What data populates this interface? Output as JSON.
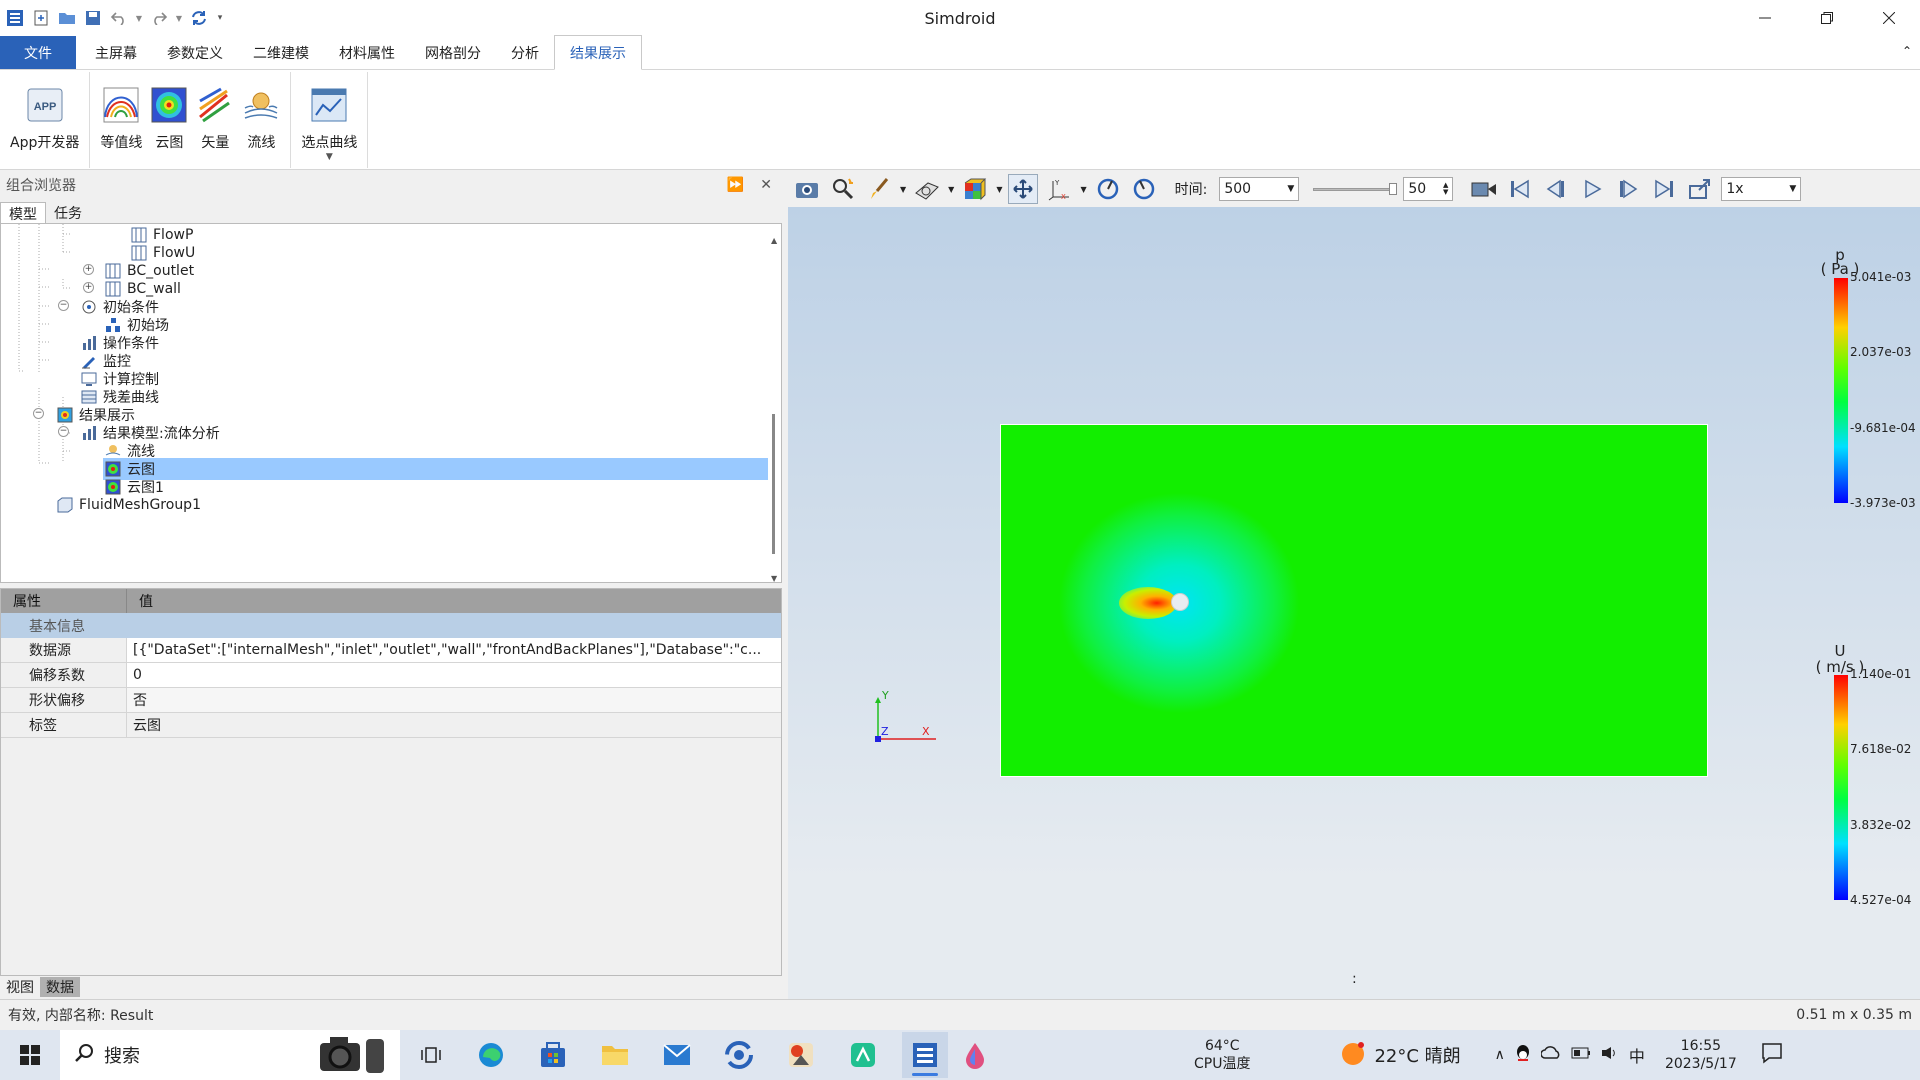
{
  "window": {
    "title": "Simdroid"
  },
  "ribbon_tabs": [
    "文件",
    "主屏幕",
    "参数定义",
    "二维建模",
    "材料属性",
    "网格剖分",
    "分析",
    "结果展示"
  ],
  "active_tab": "结果展示",
  "ribbon": {
    "app_dev": "App开发器",
    "contour_line": "等值线",
    "cloud": "云图",
    "vector": "矢量",
    "streamline": "流线",
    "pick_curve": "选点曲线"
  },
  "browser": {
    "title": "组合浏览器",
    "tabs": [
      "模型",
      "任务"
    ],
    "tree": [
      {
        "label": "FlowP"
      },
      {
        "label": "FlowU"
      },
      {
        "label": "BC_outlet"
      },
      {
        "label": "BC_wall"
      },
      {
        "label": "初始条件"
      },
      {
        "label": "初始场"
      },
      {
        "label": "操作条件"
      },
      {
        "label": "监控"
      },
      {
        "label": "计算控制"
      },
      {
        "label": "残差曲线"
      },
      {
        "label": "结果展示"
      },
      {
        "label": "结果模型:流体分析"
      },
      {
        "label": "流线"
      },
      {
        "label": "云图"
      },
      {
        "label": "云图1"
      },
      {
        "label": "FluidMeshGroup1"
      }
    ]
  },
  "properties": {
    "col_prop": "属性",
    "col_value": "值",
    "group": "基本信息",
    "rows": [
      {
        "k": "数据源",
        "v": "[{\"DataSet\":[\"internalMesh\",\"inlet\",\"outlet\",\"wall\",\"frontAndBackPlanes\"],\"Database\":\"c..."
      },
      {
        "k": "偏移系数",
        "v": "0"
      },
      {
        "k": "形状偏移",
        "v": "否"
      },
      {
        "k": "标签",
        "v": "云图"
      }
    ]
  },
  "view_tabs": [
    "视图",
    "数据"
  ],
  "view_toolbar": {
    "time_label": "时间:",
    "time_value": "500",
    "frame_value": "50",
    "speed": "1x"
  },
  "legend_p": {
    "title_var": "p",
    "title_unit": "( Pa )",
    "ticks": [
      "5.041e-03",
      "2.037e-03",
      "-9.681e-04",
      "-3.973e-03"
    ]
  },
  "legend_u": {
    "title_var": "U",
    "title_unit": "( m/s )",
    "ticks": [
      "1.140e-01",
      "7.618e-02",
      "3.832e-02",
      "4.527e-04"
    ]
  },
  "axes": {
    "x": "X",
    "y": "Y",
    "z": "Z"
  },
  "viewport_center_mark": ":",
  "status": {
    "left": "有效, 内部名称: Result",
    "right": "0.51 m x 0.35 m"
  },
  "taskbar": {
    "search": "搜索",
    "cpu_temp": "64°C",
    "cpu_label": "CPU温度",
    "weather": "22°C 晴朗",
    "ime": "中",
    "time": "16:55",
    "date": "2023/5/17"
  }
}
